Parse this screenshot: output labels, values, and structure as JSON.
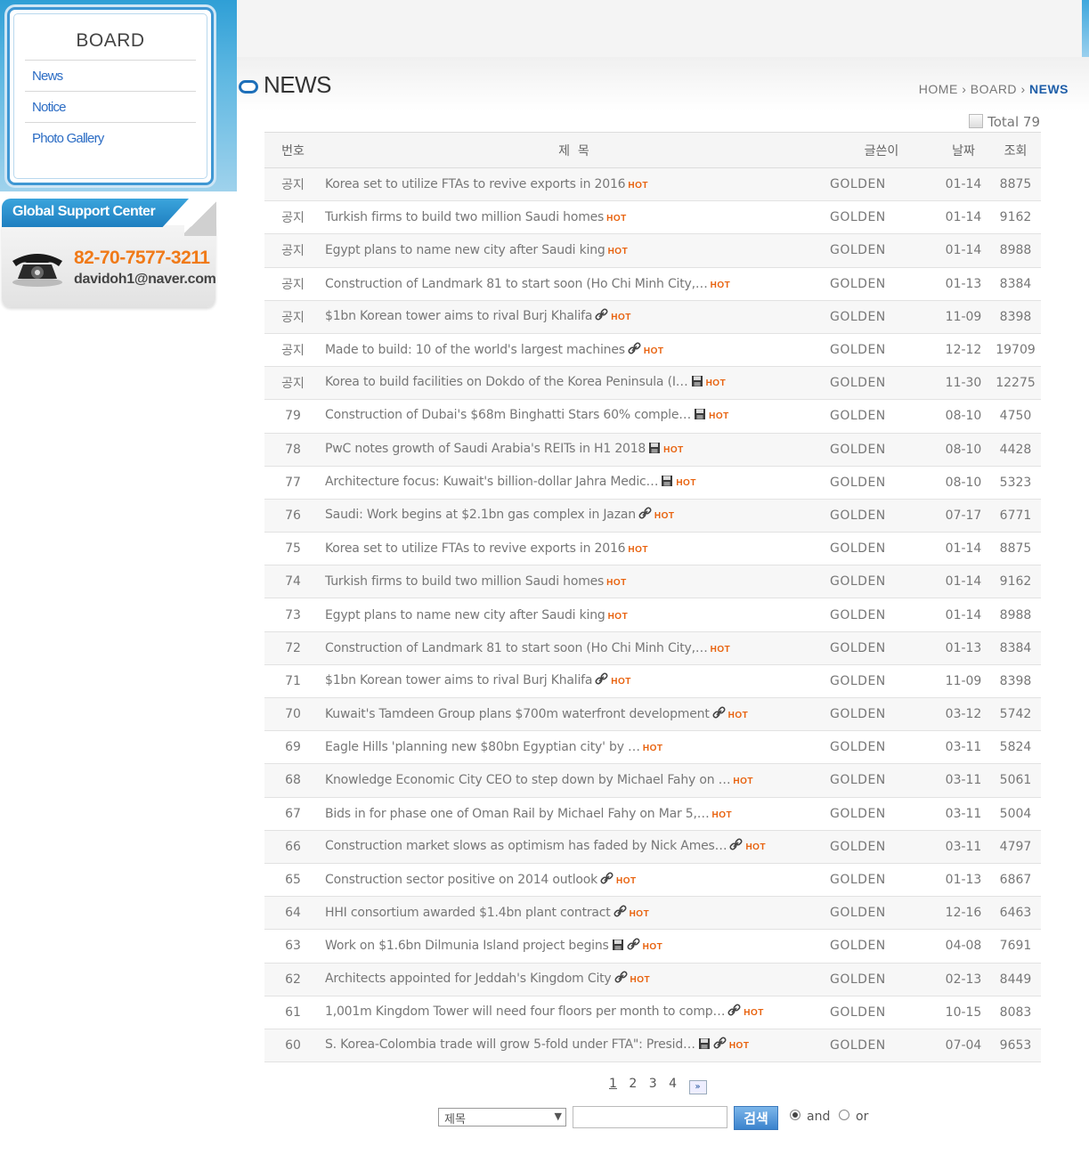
{
  "sidebar": {
    "title": "BOARD",
    "items": [
      {
        "label": "News"
      },
      {
        "label": "Notice"
      },
      {
        "label": "Photo Gallery"
      }
    ]
  },
  "support": {
    "title": "Global Support Center",
    "phone": "82-70-7577-3211",
    "email": "davidoh1@naver.com"
  },
  "header": {
    "title": "NEWS",
    "breadcrumb": [
      "HOME",
      "BOARD",
      "NEWS"
    ],
    "separator": "›",
    "total": "Total 79"
  },
  "table": {
    "columns": [
      "번호",
      "제  목",
      "글쓴이",
      "날짜",
      "조회"
    ],
    "hot_label": "HOT",
    "rows": [
      {
        "num": "공지",
        "title": "Korea set to utilize FTAs to revive exports in 2016",
        "icons": [],
        "writer": "GOLDEN",
        "date": "01-14",
        "views": "8875"
      },
      {
        "num": "공지",
        "title": "Turkish firms to build two million Saudi homes",
        "icons": [],
        "writer": "GOLDEN",
        "date": "01-14",
        "views": "9162"
      },
      {
        "num": "공지",
        "title": "Egypt plans to name new city after Saudi king",
        "icons": [],
        "writer": "GOLDEN",
        "date": "01-14",
        "views": "8988"
      },
      {
        "num": "공지",
        "title": "Construction of Landmark 81 to start soon (Ho Chi Minh City,…",
        "icons": [],
        "writer": "GOLDEN",
        "date": "01-13",
        "views": "8384"
      },
      {
        "num": "공지",
        "title": "$1bn Korean tower aims to rival Burj Khalifa",
        "icons": [
          "link-icon"
        ],
        "writer": "GOLDEN",
        "date": "11-09",
        "views": "8398"
      },
      {
        "num": "공지",
        "title": "Made to build: 10 of the world's largest machines",
        "icons": [
          "link-icon"
        ],
        "writer": "GOLDEN",
        "date": "12-12",
        "views": "19709"
      },
      {
        "num": "공지",
        "title": "Korea to build facilities on Dokdo of the Korea Peninsula (I…",
        "icons": [
          "file-icon"
        ],
        "writer": "GOLDEN",
        "date": "11-30",
        "views": "12275"
      },
      {
        "num": "79",
        "title": "Construction of Dubai's $68m Binghatti Stars 60% comple…",
        "icons": [
          "file-icon"
        ],
        "writer": "GOLDEN",
        "date": "08-10",
        "views": "4750"
      },
      {
        "num": "78",
        "title": "PwC notes growth of Saudi Arabia's REITs in H1 2018",
        "icons": [
          "file-icon"
        ],
        "writer": "GOLDEN",
        "date": "08-10",
        "views": "4428"
      },
      {
        "num": "77",
        "title": "Architecture focus: Kuwait's billion-dollar Jahra Medic…",
        "icons": [
          "file-icon"
        ],
        "writer": "GOLDEN",
        "date": "08-10",
        "views": "5323"
      },
      {
        "num": "76",
        "title": "Saudi: Work begins at $2.1bn gas complex in Jazan",
        "icons": [
          "link-icon"
        ],
        "writer": "GOLDEN",
        "date": "07-17",
        "views": "6771"
      },
      {
        "num": "75",
        "title": "Korea set to utilize FTAs to revive exports in 2016",
        "icons": [],
        "writer": "GOLDEN",
        "date": "01-14",
        "views": "8875"
      },
      {
        "num": "74",
        "title": "Turkish firms to build two million Saudi homes",
        "icons": [],
        "writer": "GOLDEN",
        "date": "01-14",
        "views": "9162"
      },
      {
        "num": "73",
        "title": "Egypt plans to name new city after Saudi king",
        "icons": [],
        "writer": "GOLDEN",
        "date": "01-14",
        "views": "8988"
      },
      {
        "num": "72",
        "title": "Construction of Landmark 81 to start soon (Ho Chi Minh City,…",
        "icons": [],
        "writer": "GOLDEN",
        "date": "01-13",
        "views": "8384"
      },
      {
        "num": "71",
        "title": "$1bn Korean tower aims to rival Burj Khalifa",
        "icons": [
          "link-icon"
        ],
        "writer": "GOLDEN",
        "date": "11-09",
        "views": "8398"
      },
      {
        "num": "70",
        "title": "Kuwait's Tamdeen Group plans $700m waterfront development",
        "icons": [
          "link-icon"
        ],
        "writer": "GOLDEN",
        "date": "03-12",
        "views": "5742"
      },
      {
        "num": "69",
        "title": "Eagle Hills 'planning new $80bn Egyptian city' by …",
        "icons": [],
        "writer": "GOLDEN",
        "date": "03-11",
        "views": "5824"
      },
      {
        "num": "68",
        "title": "Knowledge Economic City CEO to step down by Michael Fahy on …",
        "icons": [],
        "writer": "GOLDEN",
        "date": "03-11",
        "views": "5061"
      },
      {
        "num": "67",
        "title": "Bids in for phase one of Oman Rail by Michael Fahy on Mar 5,…",
        "icons": [],
        "writer": "GOLDEN",
        "date": "03-11",
        "views": "5004"
      },
      {
        "num": "66",
        "title": "Construction market slows as optimism has faded by Nick Ames…",
        "icons": [
          "link-icon"
        ],
        "writer": "GOLDEN",
        "date": "03-11",
        "views": "4797"
      },
      {
        "num": "65",
        "title": "Construction sector positive on 2014 outlook",
        "icons": [
          "link-icon"
        ],
        "writer": "GOLDEN",
        "date": "01-13",
        "views": "6867"
      },
      {
        "num": "64",
        "title": "HHI consortium awarded $1.4bn plant contract",
        "icons": [
          "link-icon"
        ],
        "writer": "GOLDEN",
        "date": "12-16",
        "views": "6463"
      },
      {
        "num": "63",
        "title": "Work on $1.6bn Dilmunia Island project begins",
        "icons": [
          "file-icon",
          "link-icon"
        ],
        "writer": "GOLDEN",
        "date": "04-08",
        "views": "7691"
      },
      {
        "num": "62",
        "title": "Architects appointed for Jeddah's Kingdom City",
        "icons": [
          "link-icon"
        ],
        "writer": "GOLDEN",
        "date": "02-13",
        "views": "8449"
      },
      {
        "num": "61",
        "title": "1,001m Kingdom Tower will need four floors per month to comp…",
        "icons": [
          "link-icon"
        ],
        "writer": "GOLDEN",
        "date": "10-15",
        "views": "8083"
      },
      {
        "num": "60",
        "title": "S. Korea-Colombia trade will grow 5-fold under FTA\": Presid…",
        "icons": [
          "file-icon",
          "link-icon"
        ],
        "writer": "GOLDEN",
        "date": "07-04",
        "views": "9653"
      }
    ]
  },
  "pager": {
    "pages": [
      "1",
      "2",
      "3",
      "4"
    ],
    "current": "1",
    "next": "»"
  },
  "search": {
    "field_selected": "제목",
    "query": "",
    "button": "검색",
    "mode_and": "and",
    "mode_or": "or",
    "mode_selected": "and"
  },
  "colors": {
    "accent": "#1e6fb9",
    "hot": "#e8620e",
    "phone": "#f07a18",
    "link": "#2b6cc4"
  }
}
